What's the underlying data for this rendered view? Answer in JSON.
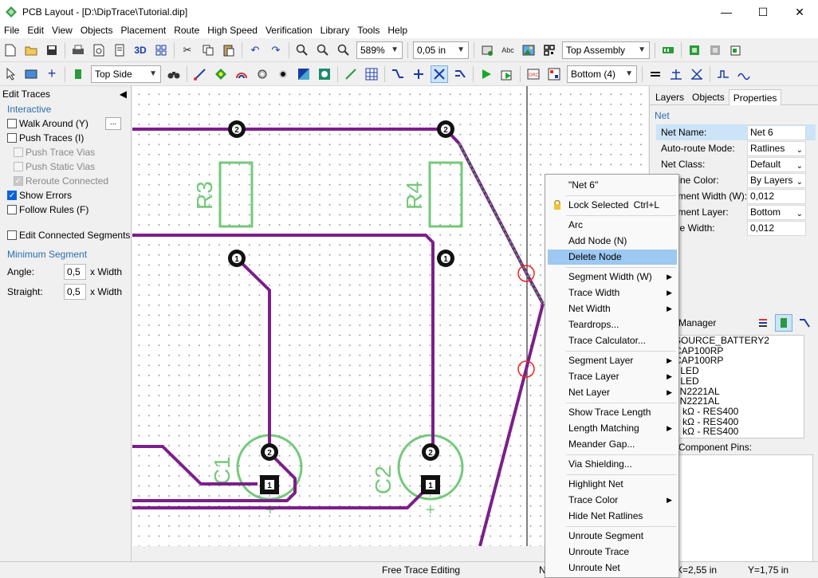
{
  "window": {
    "title": "PCB Layout - [D:\\DipTrace\\Tutorial.dip]"
  },
  "menu": [
    "File",
    "Edit",
    "View",
    "Objects",
    "Placement",
    "Route",
    "High Speed",
    "Verification",
    "Library",
    "Tools",
    "Help"
  ],
  "toolbar": {
    "zoom": "589%",
    "grid": "0,05 in",
    "assembly": "Top Assembly",
    "side": "Top Side",
    "layer": "Bottom (4)",
    "view_3d": "3D",
    "abc": "Abc"
  },
  "left_panel": {
    "title": "Edit Traces",
    "interactive_label": "Interactive",
    "walk_around": "Walk Around (Y)",
    "push_traces": "Push Traces (I)",
    "push_trace_vias": "Push Trace Vias",
    "push_static_vias": "Push Static Vias",
    "reroute_connected": "Reroute Connected",
    "show_errors": "Show Errors",
    "follow_rules": "Follow Rules (F)",
    "edit_connected": "Edit Connected Segments",
    "min_segment_label": "Minimum Segment",
    "angle_label": "Angle:",
    "angle_value": "0,5",
    "straight_label": "Straight:",
    "straight_value": "0,5",
    "unit": "x Width",
    "ellipsis": "..."
  },
  "canvas": {
    "labels": [
      "R3",
      "R4",
      "C1",
      "C2"
    ],
    "pad1": "1",
    "pad2": "2",
    "plus": "+",
    "colors": {
      "trace": "#7b1f8a",
      "silk": "#75c97a",
      "ratline": "#3ba84a",
      "error": "#ee2222"
    }
  },
  "right_panel": {
    "tabs": [
      "Layers",
      "Objects",
      "Properties"
    ],
    "section": "Net",
    "props": [
      {
        "key": "Net Name:",
        "value": "Net 6",
        "dropdown": false
      },
      {
        "key": "Auto-route Mode:",
        "value": "Ratlines",
        "dropdown": true
      },
      {
        "key": "Net Class:",
        "value": "Default",
        "dropdown": true
      },
      {
        "key": "Ratline Color:",
        "value": "By Layers",
        "dropdown": true
      },
      {
        "key": "Segment Width (W):",
        "value": "0,012",
        "dropdown": false
      },
      {
        "key": "Segment Layer:",
        "value": "Bottom",
        "dropdown": true
      },
      {
        "key": "Trace Width:",
        "value": "0,012",
        "dropdown": false
      }
    ],
    "manager_title": "Manager",
    "manager_items": [
      "SOURCE_BATTERY2",
      "CAP100RP",
      "CAP100RP",
      "- LED",
      "- LED",
      "2N2221AL",
      "2N2221AL",
      "7 kΩ - RES400",
      "7 kΩ - RES400",
      "7 kΩ - RES400"
    ],
    "pins_title": "Component Pins:"
  },
  "context_menu": {
    "items": [
      {
        "label": "\"Net 6\""
      },
      {
        "label": "Lock Selected",
        "shortcut": "Ctrl+L",
        "icon": "lock-icon"
      },
      {
        "label": "Arc"
      },
      {
        "label": "Add Node (N)"
      },
      {
        "label": "Delete Node",
        "highlight": true
      },
      {
        "label": "Segment Width (W)",
        "submenu": true
      },
      {
        "label": "Trace Width",
        "submenu": true
      },
      {
        "label": "Net Width",
        "submenu": true
      },
      {
        "label": "Teardrops..."
      },
      {
        "label": "Trace Calculator..."
      },
      {
        "label": "Segment Layer",
        "submenu": true
      },
      {
        "label": "Trace Layer",
        "submenu": true
      },
      {
        "label": "Net Layer",
        "submenu": true
      },
      {
        "label": "Show Trace Length"
      },
      {
        "label": "Length Matching",
        "submenu": true
      },
      {
        "label": "Meander Gap..."
      },
      {
        "label": "Via Shielding..."
      },
      {
        "label": "Highlight Net"
      },
      {
        "label": "Trace Color",
        "submenu": true
      },
      {
        "label": "Hide Net Ratlines"
      },
      {
        "label": "Unroute Segment"
      },
      {
        "label": "Unroute Trace"
      },
      {
        "label": "Unroute Net"
      }
    ]
  },
  "status": {
    "mode": "Free Trace Editing",
    "x": "X=2,55 in",
    "y": "Y=1,75 in",
    "n": "N"
  }
}
